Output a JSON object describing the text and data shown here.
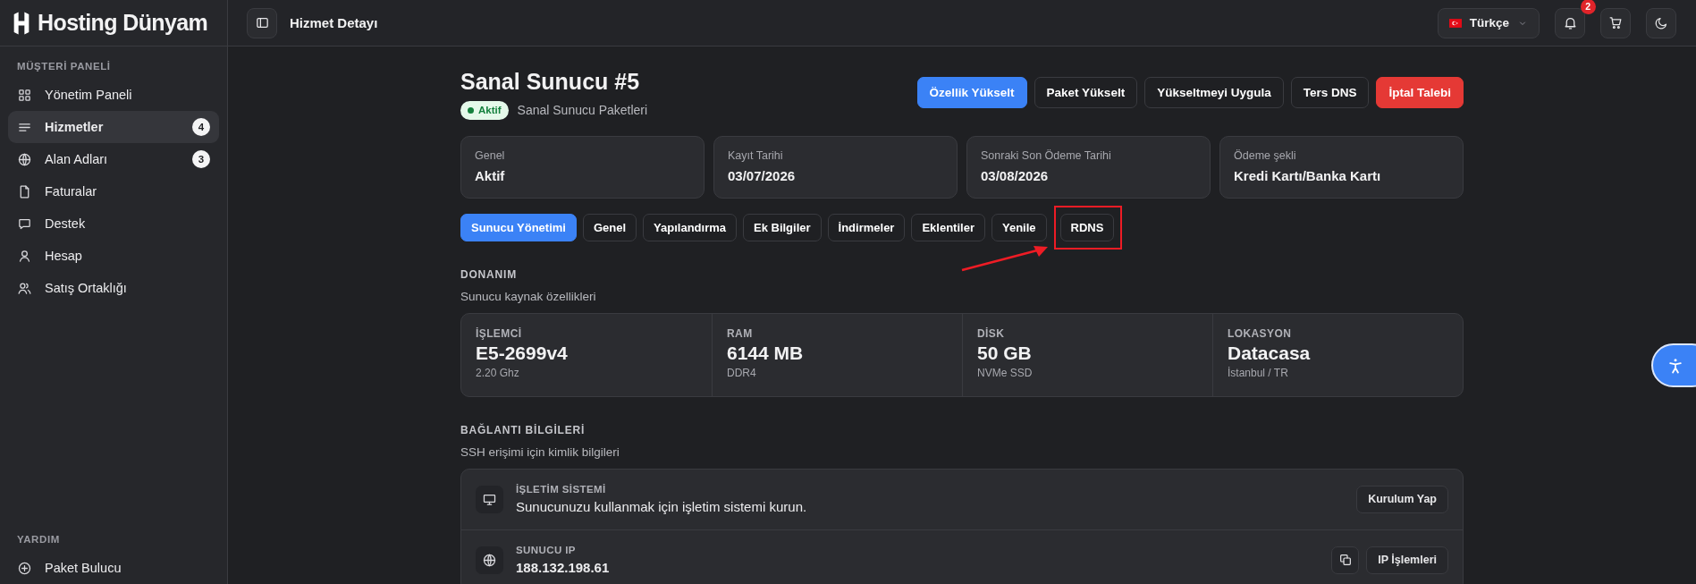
{
  "brand": {
    "name": "Hosting Dünyam"
  },
  "topbar": {
    "title": "Hizmet Detayı",
    "language": "Türkçe",
    "notifications_badge": "2"
  },
  "sidebar": {
    "sections": [
      {
        "heading": "MÜŞTERİ PANELİ",
        "items": [
          {
            "label": "Yönetim Paneli",
            "kind": "grid",
            "selected": false
          },
          {
            "label": "Hizmetler",
            "kind": "lines",
            "badge": "4",
            "selected": true
          },
          {
            "label": "Alan Adları",
            "kind": "globe",
            "badge": "3",
            "selected": false
          },
          {
            "label": "Faturalar",
            "kind": "file",
            "selected": false
          },
          {
            "label": "Destek",
            "kind": "chat",
            "selected": false
          },
          {
            "label": "Hesap",
            "kind": "user",
            "selected": false
          },
          {
            "label": "Satış Ortaklığı",
            "kind": "users",
            "selected": false
          }
        ]
      },
      {
        "heading": "YARDIM",
        "items": [
          {
            "label": "Paket Bulucu",
            "kind": "plus",
            "selected": false
          }
        ]
      }
    ]
  },
  "service": {
    "title": "Sanal Sunucu #5",
    "status": {
      "label": "Aktif",
      "kind": "active"
    },
    "category": "Sanal Sunucu Paketleri",
    "actions": [
      {
        "label": "Özellik Yükselt",
        "kind": "primary"
      },
      {
        "label": "Paket Yükselt",
        "kind": "default"
      },
      {
        "label": "Yükseltmeyi Uygula",
        "kind": "default"
      },
      {
        "label": "Ters DNS",
        "kind": "default"
      },
      {
        "label": "İptal Talebi",
        "kind": "danger"
      }
    ]
  },
  "info_cards": [
    {
      "label": "Genel",
      "value": "Aktif"
    },
    {
      "label": "Kayıt Tarihi",
      "value": "03/07/2026"
    },
    {
      "label": "Sonraki Son Ödeme Tarihi",
      "value": "03/08/2026"
    },
    {
      "label": "Ödeme şekli",
      "value": "Kredi Kartı/Banka Kartı"
    }
  ],
  "tabs": [
    {
      "label": "Sunucu Yönetimi",
      "selected": true,
      "highlighted": false
    },
    {
      "label": "Genel",
      "selected": false,
      "highlighted": false
    },
    {
      "label": "Yapılandırma",
      "selected": false,
      "highlighted": false
    },
    {
      "label": "Ek Bilgiler",
      "selected": false,
      "highlighted": false
    },
    {
      "label": "İndirmeler",
      "selected": false,
      "highlighted": false
    },
    {
      "label": "Eklentiler",
      "selected": false,
      "highlighted": false
    },
    {
      "label": "Yenile",
      "selected": false,
      "highlighted": false
    },
    {
      "label": "RDNS",
      "selected": false,
      "highlighted": true
    }
  ],
  "hardware": {
    "heading": "DONANIM",
    "subtitle": "Sunucu kaynak özellikleri",
    "items": [
      {
        "label": "İŞLEMCİ",
        "value": "E5-2699v4",
        "detail": "2.20 Ghz"
      },
      {
        "label": "RAM",
        "value": "6144 MB",
        "detail": "DDR4"
      },
      {
        "label": "DİSK",
        "value": "50 GB",
        "detail": "NVMe SSD"
      },
      {
        "label": "LOKASYON",
        "value": "Datacasa",
        "detail": "İstanbul / TR"
      }
    ]
  },
  "connection": {
    "heading": "BAĞLANTI BİLGİLERİ",
    "subtitle": "SSH erişimi için kimlik bilgileri",
    "rows": [
      {
        "kind": "monitor",
        "label": "İŞLETİM SİSTEMİ",
        "value": "Sunucunuzu kullanmak için işletim sistemi kurun.",
        "actions": [
          {
            "kind": "text",
            "label": "Kurulum Yap"
          }
        ]
      },
      {
        "kind": "globe",
        "label": "SUNUCU IP",
        "value": "188.132.198.61",
        "actions": [
          {
            "kind": "copy"
          },
          {
            "kind": "text",
            "label": "IP İşlemleri"
          }
        ]
      }
    ]
  }
}
